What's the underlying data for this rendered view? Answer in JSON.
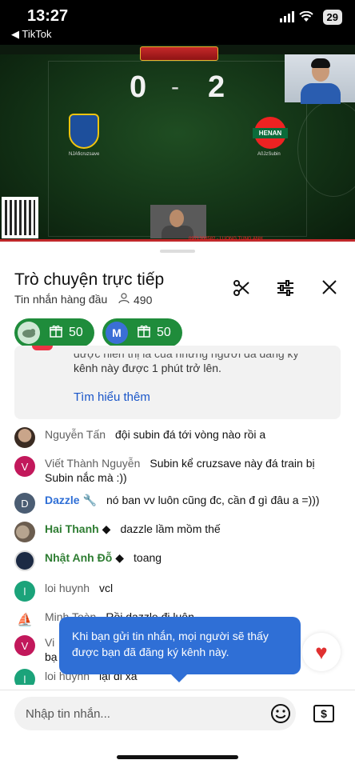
{
  "status": {
    "time": "13:27",
    "back_app": "◀ TikTok",
    "battery": "29"
  },
  "video": {
    "score_home": "0",
    "score_away": "2",
    "home_name": "NJAficruzsave",
    "away_name": "A0JzSubin",
    "away_crest_text": "HENAN",
    "ticker": "0971300582 - LUONG TUNG ANH"
  },
  "chat": {
    "title": "Trò chuyện trực tiếp",
    "subtitle": "Tin nhắn hàng đầu",
    "viewers": "490",
    "pills": [
      {
        "count": "50"
      },
      {
        "avatar_letter": "M",
        "count": "50"
      }
    ],
    "info_cut": "được hiển thị là của những người đã đăng ký",
    "info_line": "kênh này được 1 phút trở lên.",
    "info_link": "Tìm hiểu thêm",
    "messages": [
      {
        "author": "Nguyễn Tấn",
        "text": "đội subin đá tới vòng nào rồi a"
      },
      {
        "author": "Viết Thành Nguyễn",
        "avatar_letter": "V",
        "text": "Subin kể cruzsave này đá train bị Subin nắc mà :))"
      },
      {
        "author": "Dazzle",
        "avatar_letter": "D",
        "text": "nó ban vv luôn cũng đc, cần đ gì đâu a =)))"
      },
      {
        "author": "Hai Thanh",
        "text": "dazzle lầm mồm thế"
      },
      {
        "author": "Nhật Anh Đỗ",
        "text": "toang"
      },
      {
        "author": "loi huynh",
        "avatar_letter": "l",
        "text": "vcl"
      },
      {
        "author": "Minh Toàn",
        "text": "Rồi dazzle đi luôn"
      },
      {
        "author": "Vi",
        "avatar_letter": "V",
        "text": "bạ"
      },
      {
        "author": "loi huynh",
        "avatar_letter": "l",
        "text": "lại đi xa"
      }
    ],
    "tooltip": "Khi bạn gửi tin nhắn, mọi người sẽ thấy được bạn đã đăng ký kênh này.",
    "input_placeholder": "Nhập tin nhắn...",
    "colors": {
      "accent": "#2f6fd6",
      "pill_green": "#1f8c3b",
      "moderator": "#2f6fd6",
      "member": "#2e7d32"
    }
  }
}
